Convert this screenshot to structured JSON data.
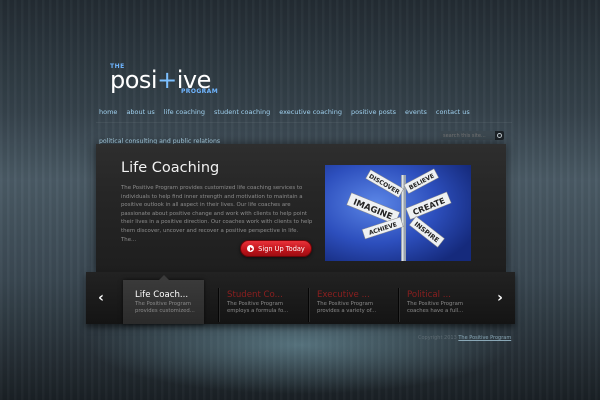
{
  "logo": {
    "the": "THE",
    "word_part1": "posi",
    "word_plus": "+",
    "word_part2": "ive",
    "program": "PROGRAM"
  },
  "nav": [
    {
      "label": "home"
    },
    {
      "label": "about us"
    },
    {
      "label": "life coaching"
    },
    {
      "label": "student coaching"
    },
    {
      "label": "executive coaching"
    },
    {
      "label": "positive posts"
    },
    {
      "label": "events"
    },
    {
      "label": "contact us"
    }
  ],
  "subnav": {
    "label": "political consulting and public relations"
  },
  "search": {
    "placeholder": "search this site..."
  },
  "slide": {
    "title": "Life Coaching",
    "text": "The Positive Program provides customized life coaching services to individuals to help find inner strength and motivation to maintain a positive outlook in all aspect in their lives.   Our life coaches are passionate about positive change and work with clients to help point their lives in a positive direction. Our coaches work with clients to help them discover, uncover and recover a positive perspective in life.  The...",
    "button_label": "Sign Up Today",
    "image_signs": [
      "DISCOVER",
      "BELIEVE",
      "IMAGINE",
      "CREATE",
      "ACHIEVE",
      "INSPIRE"
    ]
  },
  "carousel": {
    "items": [
      {
        "title": "Life Coach...",
        "desc": "The Positive Program provides customized...",
        "active": true
      },
      {
        "title": "Student Co...",
        "desc": "The Positive Program employs a formula fo..."
      },
      {
        "title": "Executive ...",
        "desc": "The Positive Program provides a variety of..."
      },
      {
        "title": "Political ...",
        "desc": "The Positive Program coaches have a full..."
      }
    ]
  },
  "footer": {
    "copyright_prefix": "Copyright 2013",
    "owner": "The Positive Program"
  }
}
